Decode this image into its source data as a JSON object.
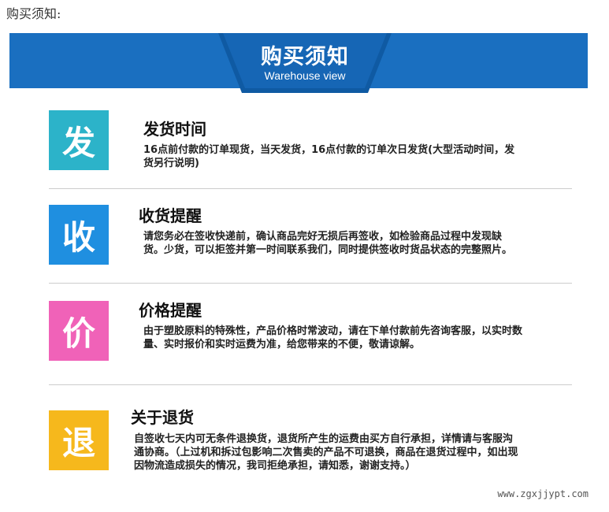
{
  "page_heading": "购买须知:",
  "banner": {
    "title": "购买须知",
    "subtitle": "Warehouse view",
    "color": "#1a6fc0"
  },
  "sections": [
    {
      "badge": "发",
      "badge_color": "#2cb3c9",
      "title": "发货时间",
      "body": "16点前付款的订单现货，当天发货，16点付款的订单次日发货(大型活动时间，发货另行说明)"
    },
    {
      "badge": "收",
      "badge_color": "#1f8fe0",
      "title": "收货提醒",
      "body": "请您务必在签收快递前，确认商品完好无损后再签收，如检验商品过程中发现缺货。少货，可以拒签并第一时间联系我们，同时提供签收时货品状态的完整照片。"
    },
    {
      "badge": "价",
      "badge_color": "#f062b8",
      "title": "价格提醒",
      "body": "由于塑胶原料的特殊性，产品价格时常波动，请在下单付款前先咨询客服，以实时数量、实时报价和实时运费为准，给您带来的不便，敬请谅解。"
    },
    {
      "badge": "退",
      "badge_color": "#f6b81c",
      "title": "关于退货",
      "body": "自签收七天内可无条件退换货，退货所产生的运费由买方自行承担，详情请与客服沟通协商。（上过机和拆过包影响二次售卖的产品不可退换，商品在退货过程中，如出现因物流造成损失的情况，我司拒绝承担，请知悉，谢谢支持。）"
    }
  ],
  "watermark": "www.zgxjjypt.com"
}
